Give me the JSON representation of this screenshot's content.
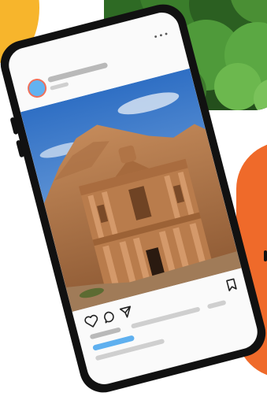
{
  "post": {
    "more_icon": "more-dots-icon",
    "like_icon": "heart-icon",
    "comment_icon": "comment-icon",
    "share_icon": "send-icon",
    "save_icon": "bookmark-icon",
    "menu_glyph": "•••"
  },
  "colors": {
    "accent_yellow": "#f7b52c",
    "accent_orange": "#ef6a2a",
    "avatar_blue": "#62b2f0",
    "avatar_ring": "#f0705a",
    "likes_bar_blue": "#5fb0ef",
    "phone_frame": "#111111",
    "screen_bg": "#fafafa",
    "placeholder_gray": "#b9b9b9"
  }
}
